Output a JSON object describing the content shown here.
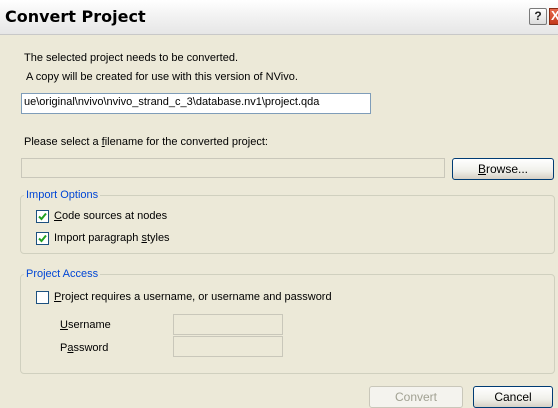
{
  "window": {
    "title": "Convert Project",
    "help_glyph": "?",
    "close_glyph": "X"
  },
  "intro": {
    "line1": "The selected project needs to be converted.",
    "line2": "A copy will be created for use with this version of NVivo."
  },
  "source_path": "ue\\original\\nvivo\\nvivo_strand_c_3\\database.nv1\\project.qda",
  "filename_prompt": {
    "before": "Please select a ",
    "key": "f",
    "after": "ilename for the converted project:"
  },
  "filename_value": "",
  "browse": {
    "key": "B",
    "rest": "rowse..."
  },
  "import_options": {
    "legend": "Import Options",
    "code_sources": {
      "before": "",
      "key": "C",
      "after": "ode sources at nodes",
      "checked": true
    },
    "paragraph_styles": {
      "before": "Import paragraph ",
      "key": "s",
      "after": "tyles",
      "checked": true
    }
  },
  "project_access": {
    "legend": "Project Access",
    "requires": {
      "before": "",
      "key": "P",
      "after": "roject requires a username, or username and password",
      "checked": false
    },
    "username": {
      "before": "",
      "key": "U",
      "after": "sername",
      "value": ""
    },
    "password": {
      "before": "P",
      "key": "a",
      "after": "ssword",
      "value": ""
    }
  },
  "buttons": {
    "convert": "Convert",
    "cancel": "Cancel"
  }
}
